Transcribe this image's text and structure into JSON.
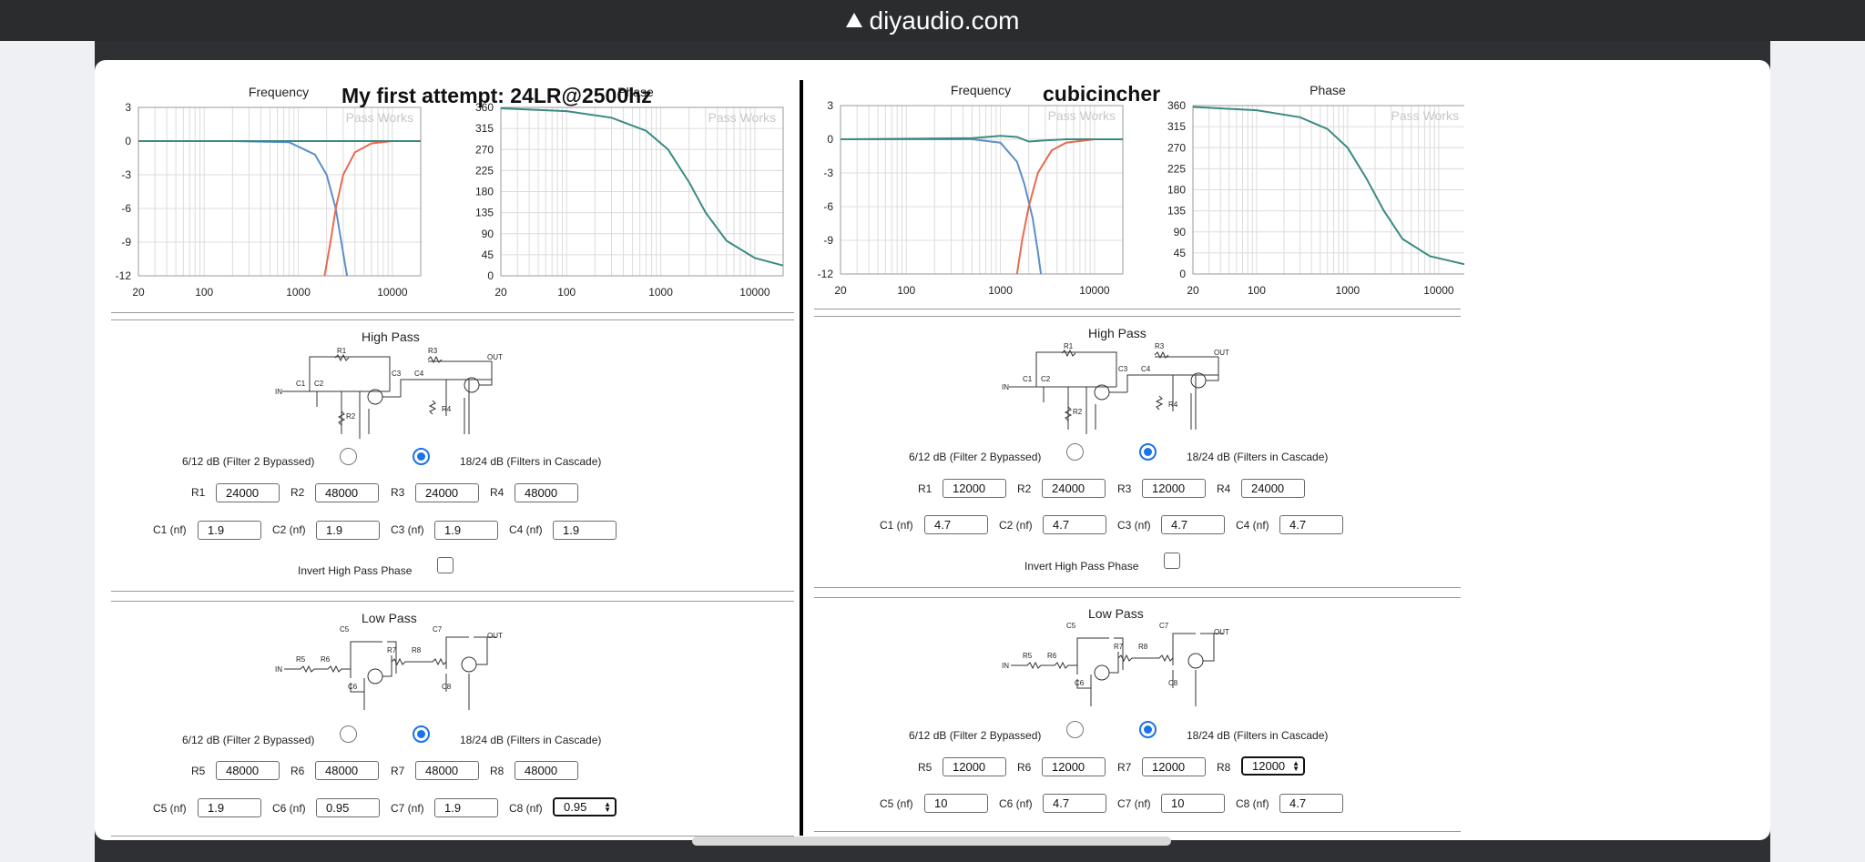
{
  "browser": {
    "domain": "diyaudio.com"
  },
  "left": {
    "title": "My first attempt: 24LR@2500hz",
    "freq_title": "Frequency",
    "phase_title": "Phase",
    "watermark": "Pass Works",
    "high_pass": {
      "title": "High Pass",
      "opt1": "6/12 dB (Filter 2 Bypassed)",
      "opt2": "18/24 dB (Filters in Cascade)",
      "selected": "opt2",
      "r_labels": [
        "R1",
        "R2",
        "R3",
        "R4"
      ],
      "r_values": [
        "24000",
        "48000",
        "24000",
        "48000"
      ],
      "c_labels": [
        "C1 (nf)",
        "C2 (nf)",
        "C3 (nf)",
        "C4 (nf)"
      ],
      "c_values": [
        "1.9",
        "1.9",
        "1.9",
        "1.9"
      ],
      "invert_label": "Invert High Pass Phase"
    },
    "low_pass": {
      "title": "Low Pass",
      "opt1": "6/12 dB (Filter 2 Bypassed)",
      "opt2": "18/24 dB (Filters in Cascade)",
      "selected": "opt2",
      "r_labels": [
        "R5",
        "R6",
        "R7",
        "R8"
      ],
      "r_values": [
        "48000",
        "48000",
        "48000",
        "48000"
      ],
      "c_labels": [
        "C5 (nf)",
        "C6 (nf)",
        "C7 (nf)",
        "C8 (nf)"
      ],
      "c_values": [
        "1.9",
        "0.95",
        "1.9",
        "0.95"
      ]
    }
  },
  "right": {
    "title": "cubicincher",
    "freq_title": "Frequency",
    "phase_title": "Phase",
    "watermark": "Pass Works",
    "high_pass": {
      "title": "High Pass",
      "opt1": "6/12 dB (Filter 2 Bypassed)",
      "opt2": "18/24 dB (Filters in Cascade)",
      "selected": "opt2",
      "r_labels": [
        "R1",
        "R2",
        "R3",
        "R4"
      ],
      "r_values": [
        "12000",
        "24000",
        "12000",
        "24000"
      ],
      "c_labels": [
        "C1 (nf)",
        "C2 (nf)",
        "C3 (nf)",
        "C4 (nf)"
      ],
      "c_values": [
        "4.7",
        "4.7",
        "4.7",
        "4.7"
      ],
      "invert_label": "Invert High Pass Phase"
    },
    "low_pass": {
      "title": "Low Pass",
      "opt1": "6/12 dB (Filter 2 Bypassed)",
      "opt2": "18/24 dB (Filters in Cascade)",
      "selected": "opt2",
      "r_labels": [
        "R5",
        "R6",
        "R7",
        "R8"
      ],
      "r_values": [
        "12000",
        "12000",
        "12000",
        "12000"
      ],
      "c_labels": [
        "C5 (nf)",
        "C6 (nf)",
        "C7 (nf)",
        "C8 (nf)"
      ],
      "c_values": [
        "10",
        "4.7",
        "10",
        "4.7"
      ]
    }
  },
  "chart_data": [
    {
      "type": "line",
      "panel": "left",
      "title": "Frequency",
      "x_scale": "log",
      "xlim": [
        20,
        20000
      ],
      "ylim": [
        -12,
        3
      ],
      "x_ticks": [
        "20",
        "100",
        "1000",
        "10000"
      ],
      "y_ticks": [
        "3",
        "0",
        "-3",
        "-6",
        "-9",
        "-12"
      ],
      "series": [
        {
          "color": "#5b8fc7",
          "x": [
            20,
            200,
            800,
            1500,
            2000,
            2500,
            3000,
            3300
          ],
          "y": [
            0,
            0,
            -0.1,
            -1.2,
            -3,
            -6,
            -10,
            -12
          ]
        },
        {
          "color": "#e86a4f",
          "x": [
            1900,
            2200,
            2500,
            3000,
            4000,
            6000,
            10000,
            20000
          ],
          "y": [
            -12,
            -9,
            -6,
            -3,
            -1,
            -0.2,
            0,
            0
          ]
        },
        {
          "color": "#3b8a82",
          "x": [
            20,
            1000,
            2500,
            10000,
            20000
          ],
          "y": [
            0,
            0,
            0,
            0,
            0
          ]
        }
      ],
      "grid": true
    },
    {
      "type": "line",
      "panel": "left",
      "title": "Phase",
      "x_scale": "log",
      "xlim": [
        20,
        20000
      ],
      "ylim": [
        0,
        360
      ],
      "x_ticks": [
        "20",
        "100",
        "1000",
        "10000"
      ],
      "y_ticks": [
        "360",
        "315",
        "270",
        "225",
        "180",
        "135",
        "90",
        "45",
        "0"
      ],
      "series": [
        {
          "color": "#3b8a82",
          "x": [
            20,
            100,
            300,
            700,
            1200,
            2000,
            3000,
            5000,
            10000,
            20000
          ],
          "y": [
            358,
            352,
            338,
            310,
            270,
            200,
            135,
            75,
            38,
            22
          ]
        }
      ],
      "grid": true
    },
    {
      "type": "line",
      "panel": "right",
      "title": "Frequency",
      "x_scale": "log",
      "xlim": [
        20,
        20000
      ],
      "ylim": [
        -12,
        3
      ],
      "x_ticks": [
        "20",
        "100",
        "1000",
        "10000"
      ],
      "y_ticks": [
        "3",
        "0",
        "-3",
        "-6",
        "-9",
        "-12"
      ],
      "series": [
        {
          "color": "#5b8fc7",
          "x": [
            20,
            500,
            1000,
            1500,
            1800,
            2200,
            2500,
            2700
          ],
          "y": [
            0,
            0,
            -0.3,
            -2,
            -4,
            -7,
            -10,
            -12
          ]
        },
        {
          "color": "#e86a4f",
          "x": [
            1500,
            1700,
            2000,
            2500,
            3500,
            5000,
            10000,
            20000
          ],
          "y": [
            -12,
            -9,
            -6,
            -3,
            -1,
            -0.3,
            0,
            0
          ]
        },
        {
          "color": "#3b8a82",
          "x": [
            20,
            500,
            1000,
            1500,
            2000,
            3000,
            5000,
            20000
          ],
          "y": [
            0,
            0.1,
            0.3,
            0.2,
            -0.2,
            -0.1,
            0,
            0
          ]
        }
      ],
      "grid": true
    },
    {
      "type": "line",
      "panel": "right",
      "title": "Phase",
      "x_scale": "log",
      "xlim": [
        20,
        20000
      ],
      "ylim": [
        0,
        360
      ],
      "x_ticks": [
        "20",
        "100",
        "1000",
        "10000"
      ],
      "y_ticks": [
        "360",
        "315",
        "270",
        "225",
        "180",
        "135",
        "90",
        "45",
        "0"
      ],
      "series": [
        {
          "color": "#3b8a82",
          "x": [
            20,
            100,
            300,
            600,
            1000,
            1600,
            2500,
            4000,
            8000,
            20000
          ],
          "y": [
            357,
            350,
            335,
            310,
            270,
            205,
            135,
            75,
            38,
            20
          ]
        }
      ],
      "grid": true
    }
  ]
}
